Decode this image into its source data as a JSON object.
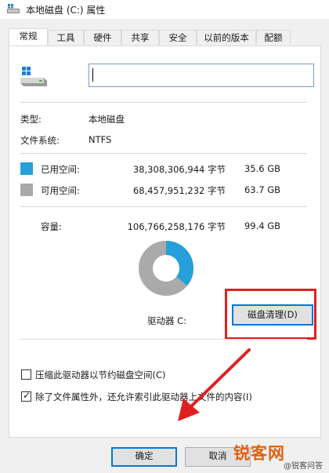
{
  "window": {
    "title": "本地磁盘 (C:) 属性"
  },
  "tabs": [
    {
      "label": "常规",
      "active": true
    },
    {
      "label": "工具"
    },
    {
      "label": "硬件"
    },
    {
      "label": "共享"
    },
    {
      "label": "安全"
    },
    {
      "label": "以前的版本"
    },
    {
      "label": "配额"
    }
  ],
  "general": {
    "name_value": "",
    "type_label": "类型:",
    "type_value": "本地磁盘",
    "fs_label": "文件系统:",
    "fs_value": "NTFS",
    "used_label": "已用空间:",
    "used_bytes": "38,308,306,944 字节",
    "used_gb": "35.6 GB",
    "free_label": "可用空间:",
    "free_bytes": "68,457,951,232 字节",
    "free_gb": "63.7 GB",
    "capacity_label": "容量:",
    "capacity_bytes": "106,766,258,176 字节",
    "capacity_gb": "99.4 GB",
    "drive_label": "驱动器 C:",
    "cleanup_button": "磁盘清理(D)",
    "compress_label": "压缩此驱动器以节约磁盘空间(C)",
    "compress_checked": false,
    "index_label": "除了文件属性外，还允许索引此驱动器上文件的内容(I)",
    "index_checked": true,
    "used_fraction": 0.359,
    "colors": {
      "used": "#26a0da",
      "free": "#aaaaaa"
    }
  },
  "buttons": {
    "ok": "确定",
    "cancel": "取消"
  },
  "watermark": {
    "main": "锐客网",
    "sub": "@锐客问答"
  }
}
